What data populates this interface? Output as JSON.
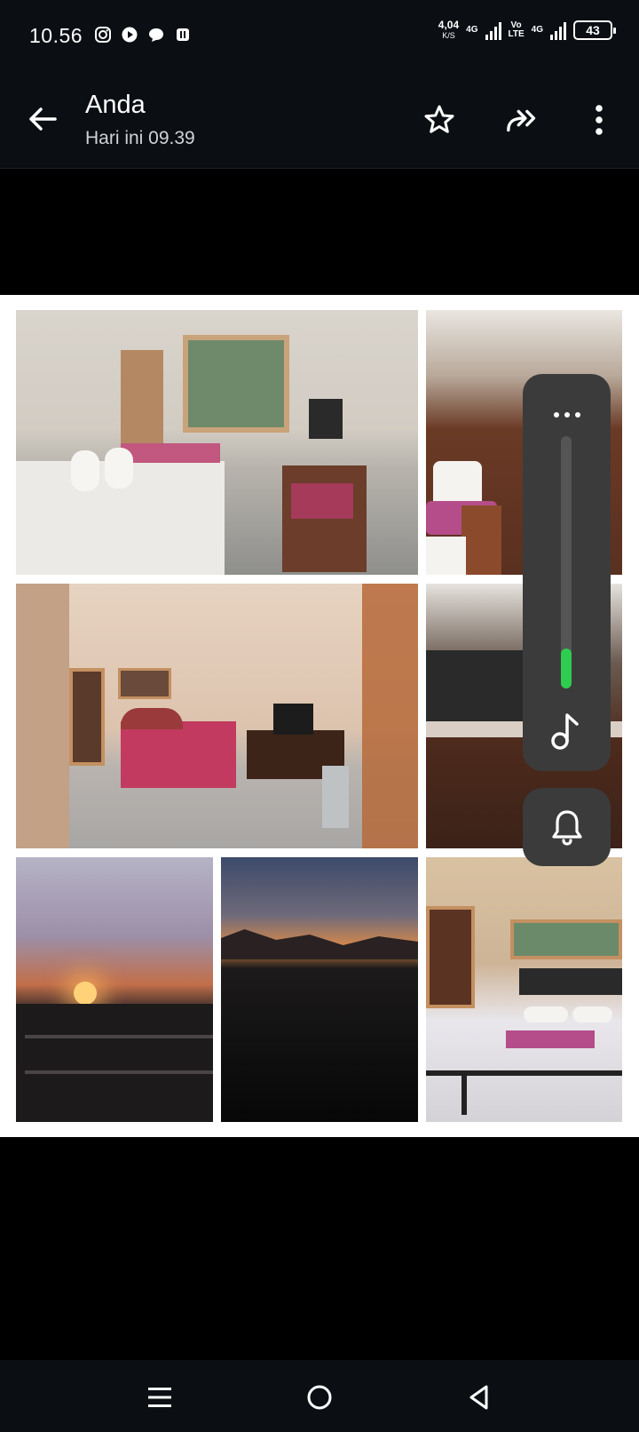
{
  "status_bar": {
    "time": "10.56",
    "net_speed_value": "4,04",
    "net_speed_unit": "K/S",
    "sim1_label": "4G",
    "volte_top": "Vo",
    "volte_bottom": "LTE",
    "sim2_label": "4G",
    "battery_level": "43",
    "icons": [
      "instagram-icon",
      "play-icon",
      "chat-icon",
      "app-icon"
    ]
  },
  "header": {
    "sender": "Anda",
    "timestamp": "Hari ini 09.39",
    "actions": [
      "back-arrow-icon",
      "star-icon",
      "forward-icon",
      "more-vert-icon"
    ]
  },
  "media": {
    "type": "photo-collage",
    "tiles": [
      {
        "subject": "bedroom-with-window"
      },
      {
        "subject": "bathroom"
      },
      {
        "subject": "bedroom-with-tv"
      },
      {
        "subject": "bathroom-sink"
      },
      {
        "subject": "sunset-balcony"
      },
      {
        "subject": "sunset-hills"
      },
      {
        "subject": "bedroom-bed"
      }
    ]
  },
  "volume_overlay": {
    "level_fraction": 0.16,
    "stream": "media",
    "fill_color": "#2ecc4f",
    "icons": [
      "more-horiz-icon",
      "music-note-icon",
      "bell-icon"
    ]
  },
  "nav_bar": {
    "buttons": [
      "menu-icon",
      "home-icon",
      "back-icon"
    ]
  },
  "colors": {
    "bar_background": "#0b0f14",
    "viewer_background": "#000000",
    "overlay_panel": "#3b3b3b"
  }
}
